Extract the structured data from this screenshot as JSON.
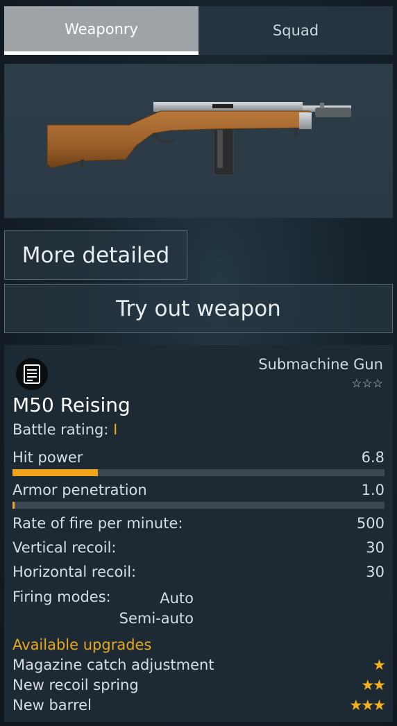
{
  "tabs": [
    {
      "label": "Weaponry",
      "active": true
    },
    {
      "label": "Squad",
      "active": false
    }
  ],
  "buttons": {
    "more_detailed": "More detailed",
    "try_out": "Try out weapon"
  },
  "weapon": {
    "icon": "weapon-class-icon",
    "class": "Submachine Gun",
    "class_stars": "☆☆☆",
    "name": "M50 Reising",
    "battle_rating_label": "Battle rating:",
    "battle_rating_value": "I"
  },
  "stats": {
    "hit_power": {
      "label": "Hit power",
      "value": "6.8",
      "bar_fraction": 0.23
    },
    "armor_penetration": {
      "label": "Armor penetration",
      "value": "1.0",
      "bar_fraction": 0.005
    },
    "rate_of_fire": {
      "label": "Rate of fire per minute:",
      "value": "500"
    },
    "vertical_recoil": {
      "label": "Vertical recoil:",
      "value": "30"
    },
    "horizontal_recoil": {
      "label": "Horizontal recoil:",
      "value": "30"
    },
    "firing_modes_label": "Firing modes:",
    "firing_modes": [
      "Auto",
      "Semi-auto"
    ]
  },
  "upgrades": {
    "title": "Available upgrades",
    "items": [
      {
        "name": "Magazine catch adjustment",
        "stars": "★"
      },
      {
        "name": "New recoil spring",
        "stars": "★★"
      },
      {
        "name": "New barrel",
        "stars": "★★★"
      }
    ]
  },
  "colors": {
    "accent": "#f2a51c",
    "bar_track": "#3c4851"
  }
}
